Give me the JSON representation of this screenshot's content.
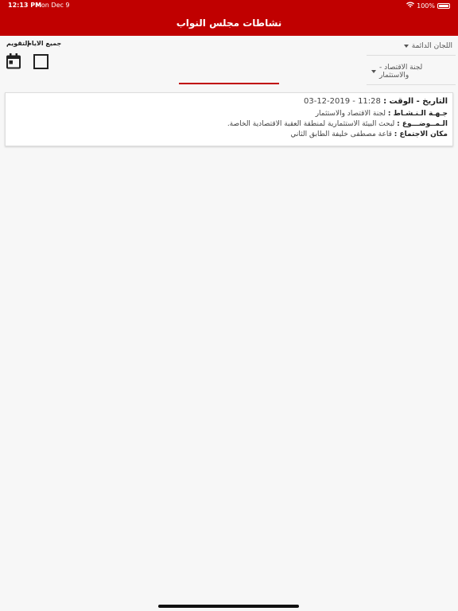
{
  "status_bar": {
    "time": "12:13 PM",
    "date": "Mon Dec 9",
    "battery": "100%"
  },
  "header": {
    "title": "نشاطات مجلس النواب"
  },
  "toolbar": {
    "calendar_label": "التقويم",
    "all_days_label": "جميع الايام"
  },
  "filters": {
    "committee_type": "اللجان الدائمة",
    "committee": "- لجنة الاقتصاد والاستثمار"
  },
  "activities": [
    {
      "datetime_key": "التاريخ - الوقت :",
      "datetime_value": "03-12-2019 - 11:28",
      "body_key": "جـهـة الـنـشـاط :",
      "body_value": "لجنة الاقتصاد والاستثمار",
      "subject_key": "الـمــوضـــوع :",
      "subject_value": "لبحث البيئة الاستثمارية لمنطقة العقبة الاقتصادية الخاصة.",
      "location_key": "مكان الاجتماع :",
      "location_value": "قاعة مصطفى خليفة الطابق الثاني"
    }
  ],
  "colors": {
    "brand": "#c00000",
    "background": "#f7f7f7"
  }
}
